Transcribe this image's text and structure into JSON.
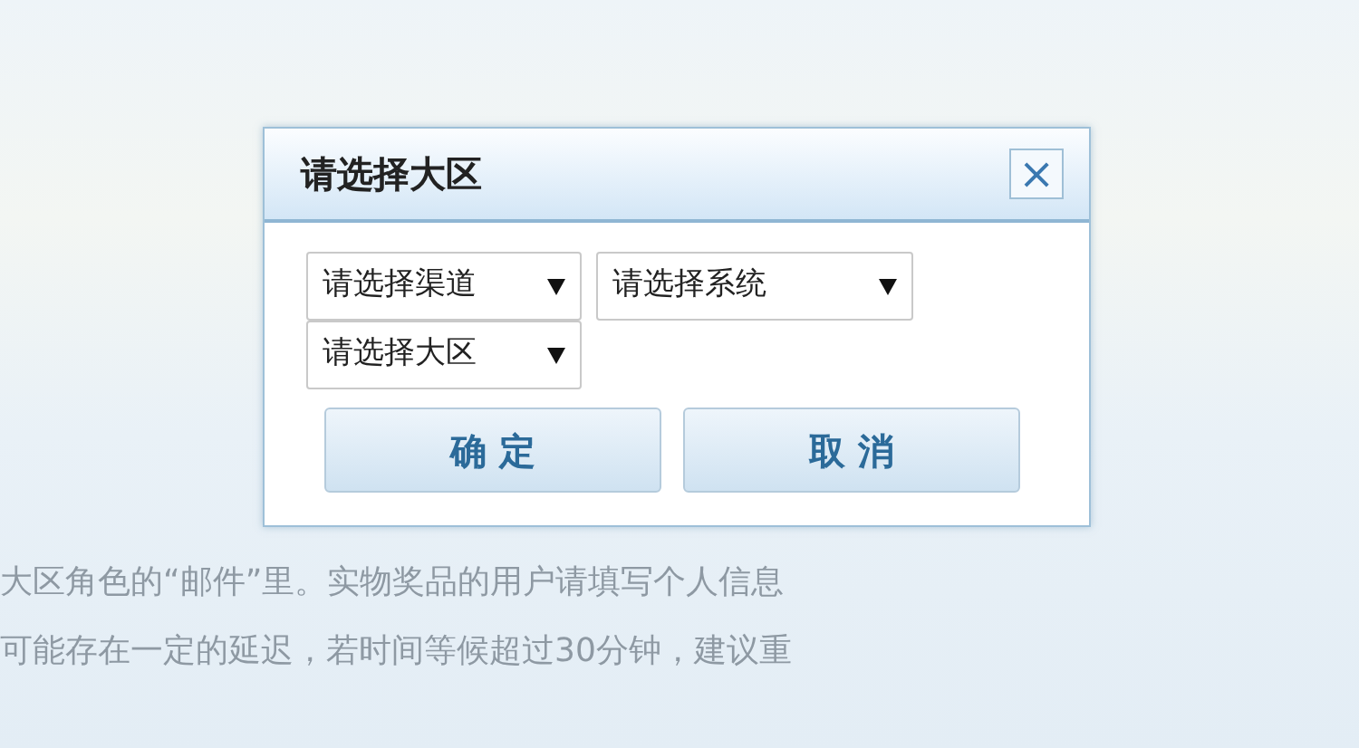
{
  "page": {
    "lines": [
      "大区角色的“邮件”里。实物奖品的用户请填写个人信息",
      "可能存在一定的延迟，若时间等候超过30分钟，建议重"
    ]
  },
  "dialog": {
    "title": "请选择大区",
    "close": "×",
    "dropdowns": [
      {
        "value": "请选择渠道"
      },
      {
        "value": "请选择系统"
      },
      {
        "value": "请选择大区"
      }
    ],
    "buttons": [
      "确 定",
      "取 消"
    ]
  }
}
